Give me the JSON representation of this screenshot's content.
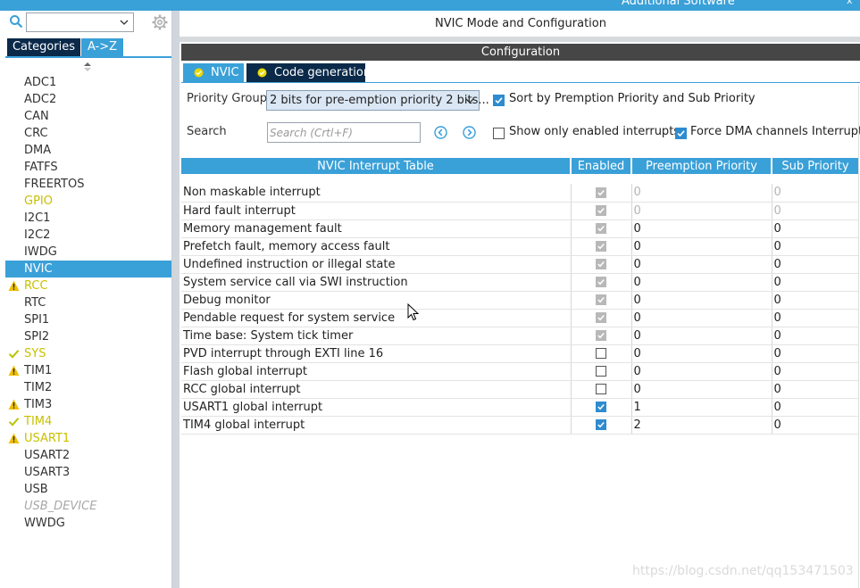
{
  "top_strip": {
    "label": "Additional Software",
    "close": "x"
  },
  "left": {
    "search_value": "",
    "tabs": [
      "Categories",
      "A->Z"
    ],
    "peripherals": [
      {
        "name": "ADC1",
        "status": "none",
        "style": "normal"
      },
      {
        "name": "ADC2",
        "status": "none",
        "style": "normal"
      },
      {
        "name": "CAN",
        "status": "none",
        "style": "normal"
      },
      {
        "name": "CRC",
        "status": "none",
        "style": "normal"
      },
      {
        "name": "DMA",
        "status": "none",
        "style": "normal"
      },
      {
        "name": "FATFS",
        "status": "none",
        "style": "normal"
      },
      {
        "name": "FREERTOS",
        "status": "none",
        "style": "normal"
      },
      {
        "name": "GPIO",
        "status": "none",
        "style": "yellow"
      },
      {
        "name": "I2C1",
        "status": "none",
        "style": "normal"
      },
      {
        "name": "I2C2",
        "status": "none",
        "style": "normal"
      },
      {
        "name": "IWDG",
        "status": "none",
        "style": "normal"
      },
      {
        "name": "NVIC",
        "status": "none",
        "style": "selected"
      },
      {
        "name": "RCC",
        "status": "warning",
        "style": "yellow"
      },
      {
        "name": "RTC",
        "status": "none",
        "style": "normal"
      },
      {
        "name": "SPI1",
        "status": "none",
        "style": "normal"
      },
      {
        "name": "SPI2",
        "status": "none",
        "style": "normal"
      },
      {
        "name": "SYS",
        "status": "check",
        "style": "yellow"
      },
      {
        "name": "TIM1",
        "status": "warning",
        "style": "normal"
      },
      {
        "name": "TIM2",
        "status": "none",
        "style": "normal"
      },
      {
        "name": "TIM3",
        "status": "warning",
        "style": "normal"
      },
      {
        "name": "TIM4",
        "status": "check",
        "style": "yellow"
      },
      {
        "name": "USART1",
        "status": "warning",
        "style": "yellow"
      },
      {
        "name": "USART2",
        "status": "none",
        "style": "normal"
      },
      {
        "name": "USART3",
        "status": "none",
        "style": "normal"
      },
      {
        "name": "USB",
        "status": "none",
        "style": "normal"
      },
      {
        "name": "USB_DEVICE",
        "status": "none",
        "style": "disabled"
      },
      {
        "name": "WWDG",
        "status": "none",
        "style": "normal"
      }
    ]
  },
  "right": {
    "title": "NVIC Mode and Configuration",
    "config_header": "Configuration",
    "tabs": [
      "NVIC",
      "Code generation"
    ],
    "priority_group_label": "Priority Group",
    "priority_group_value": "2 bits for pre-emption priority 2 bits...",
    "sort_label": "Sort by Premption Priority and Sub Priority",
    "sort_checked": true,
    "search_label": "Search",
    "search_placeholder": "Search (Crtl+F)",
    "show_enabled_label": "Show only enabled interrupts",
    "show_enabled_checked": false,
    "force_dma_label": "Force DMA channels Interrupts",
    "force_dma_checked": true
  },
  "table": {
    "headers": [
      "NVIC Interrupt Table",
      "Enabled",
      "Preemption Priority",
      "Sub Priority"
    ],
    "rows": [
      {
        "name": "Non maskable interrupt",
        "enabled": "readonly",
        "preemption": "0",
        "sub": "0",
        "muted": true
      },
      {
        "name": "Hard fault interrupt",
        "enabled": "readonly",
        "preemption": "0",
        "sub": "0",
        "muted": true
      },
      {
        "name": "Memory management fault",
        "enabled": "readonly",
        "preemption": "0",
        "sub": "0",
        "muted": false
      },
      {
        "name": "Prefetch fault, memory access fault",
        "enabled": "readonly",
        "preemption": "0",
        "sub": "0",
        "muted": false
      },
      {
        "name": "Undefined instruction or illegal state",
        "enabled": "readonly",
        "preemption": "0",
        "sub": "0",
        "muted": false
      },
      {
        "name": "System service call via SWI instruction",
        "enabled": "readonly",
        "preemption": "0",
        "sub": "0",
        "muted": false
      },
      {
        "name": "Debug monitor",
        "enabled": "readonly",
        "preemption": "0",
        "sub": "0",
        "muted": false
      },
      {
        "name": "Pendable request for system service",
        "enabled": "readonly",
        "preemption": "0",
        "sub": "0",
        "muted": false
      },
      {
        "name": "Time base: System tick timer",
        "enabled": "readonly",
        "preemption": "0",
        "sub": "0",
        "muted": false
      },
      {
        "name": "PVD interrupt through EXTI line 16",
        "enabled": "off",
        "preemption": "0",
        "sub": "0",
        "muted": false
      },
      {
        "name": "Flash global interrupt",
        "enabled": "off",
        "preemption": "0",
        "sub": "0",
        "muted": false
      },
      {
        "name": "RCC global interrupt",
        "enabled": "off",
        "preemption": "0",
        "sub": "0",
        "muted": false
      },
      {
        "name": "USART1 global interrupt",
        "enabled": "on",
        "preemption": "1",
        "sub": "0",
        "muted": false
      },
      {
        "name": "TIM4 global interrupt",
        "enabled": "on",
        "preemption": "2",
        "sub": "0",
        "muted": false
      }
    ]
  },
  "watermark": "https://blog.csdn.net/qq153471503",
  "colors": {
    "accent": "#3aa0d8",
    "dark_tab": "#0b2a4a",
    "config_bar": "#464646",
    "warning": "#f0c000",
    "check": "#b8c400"
  }
}
